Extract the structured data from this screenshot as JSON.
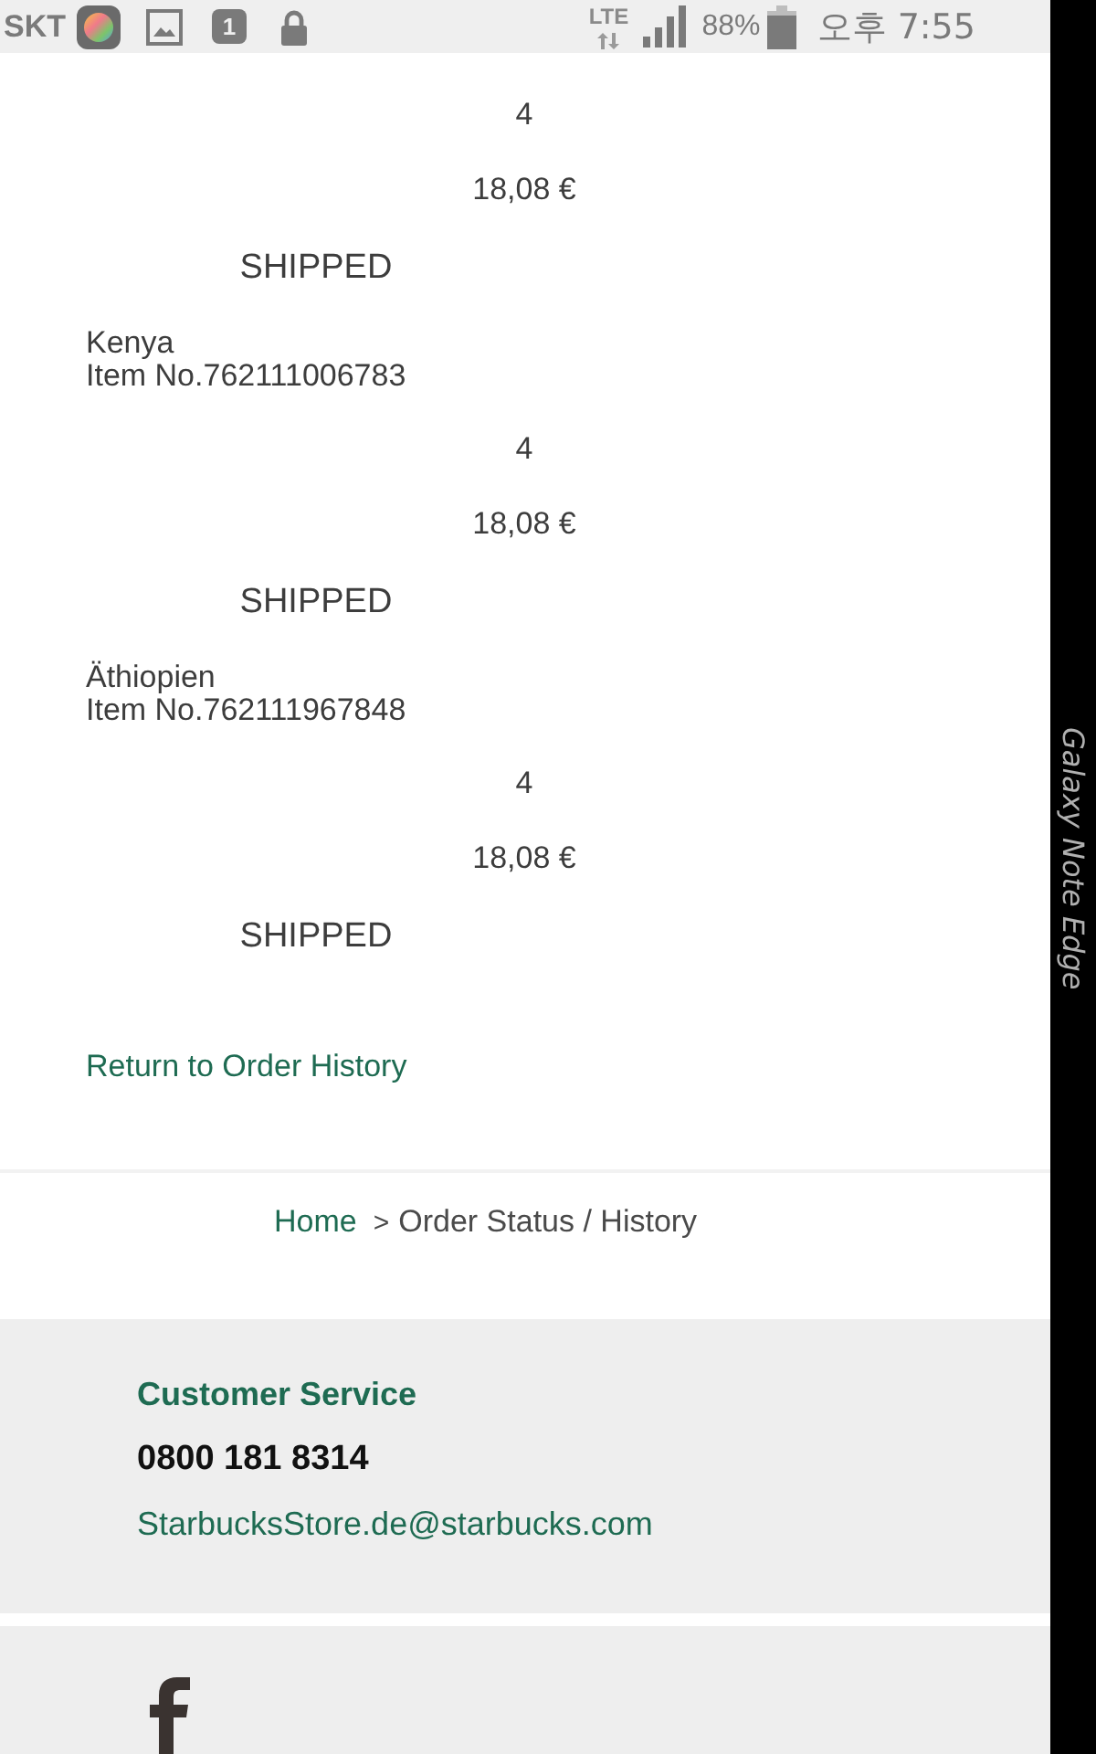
{
  "status_bar": {
    "carrier": "SKT",
    "notification_count": "1",
    "network": "LTE",
    "battery": "88%",
    "time": "오후 7:55"
  },
  "order_items": [
    {
      "quantity": "4",
      "price": "18,08 €",
      "status": "SHIPPED"
    },
    {
      "name": "Kenya",
      "item_number": "Item No.762111006783",
      "quantity": "4",
      "price": "18,08 €",
      "status": "SHIPPED"
    },
    {
      "name": "Äthiopien",
      "item_number": "Item No.762111967848",
      "quantity": "4",
      "price": "18,08 €",
      "status": "SHIPPED"
    }
  ],
  "return_link": "Return to Order History",
  "breadcrumb": {
    "separator": ">",
    "items": [
      {
        "label": "Home",
        "kind": "link"
      },
      {
        "label": "Order Status / History",
        "kind": "current"
      }
    ]
  },
  "footer": {
    "heading": "Customer Service",
    "phone": "0800 181 8314",
    "email": "StarbucksStore.de@starbucks.com"
  },
  "device_edge": {
    "label": "Galaxy Note Edge"
  }
}
